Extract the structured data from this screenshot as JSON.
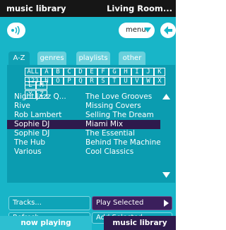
{
  "title": {
    "left": "music library",
    "right": "Living Room..."
  },
  "toolbar": {
    "menu_label": "menu"
  },
  "tabs": [
    {
      "label": "A-Z"
    },
    {
      "label": "genres"
    },
    {
      "label": "playlists"
    },
    {
      "label": "other"
    }
  ],
  "alpha_rows": [
    [
      "ALL",
      "A",
      "B",
      "C",
      "D",
      "E",
      "F",
      "G",
      "H",
      "I",
      "J",
      "K",
      "L",
      "M"
    ],
    [
      "123",
      "N",
      "O",
      "P",
      "Q",
      "R",
      "S",
      "T",
      "U",
      "V",
      "W",
      "X",
      "Y",
      "Z"
    ]
  ],
  "list": [
    {
      "artist": "Night Jazz Q...",
      "album": "The Love Grooves"
    },
    {
      "artist": "Rive",
      "album": "Missing Covers"
    },
    {
      "artist": "Rob Lambert",
      "album": "Selling The Dream"
    },
    {
      "artist": "Sophie DJ",
      "album": "Miami Mix"
    },
    {
      "artist": "Sophie DJ",
      "album": "The Essential"
    },
    {
      "artist": "The Hub",
      "album": "Behind The Machine"
    },
    {
      "artist": "Various",
      "album": "Cool Classics"
    }
  ],
  "selected_index": 3,
  "buttons": {
    "tracks": "Tracks...",
    "play_selected": "Play Selected",
    "refresh": "Refresh...",
    "add_selected": "Add Selected"
  },
  "bottom": {
    "now_playing": "now playing",
    "music_library": "music library"
  },
  "colors": {
    "bg": "#18b5c8",
    "titlebar": "#161616",
    "panel": "#0b9cb0",
    "accent_purple": "#3b1f5c",
    "selected": "#2e1a4c"
  }
}
